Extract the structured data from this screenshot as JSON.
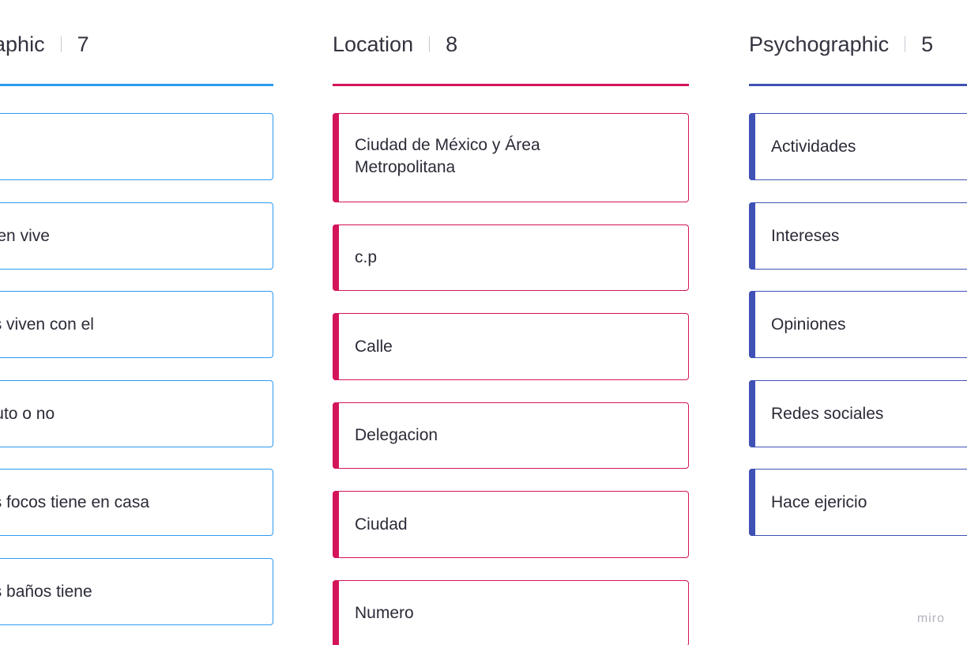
{
  "columns": [
    {
      "id": "demographic",
      "title": "Demographic",
      "count": "7",
      "color": "#2d9bf0",
      "cards": [
        {
          "text": ""
        },
        {
          "text": "Con quien vive"
        },
        {
          "text": "Cuantos viven con el"
        },
        {
          "text": "Tiene auto o no"
        },
        {
          "text": "Cuantos focos tiene en casa"
        },
        {
          "text": "Cuantos baños tiene"
        }
      ]
    },
    {
      "id": "location",
      "title": "Location",
      "count": "8",
      "color": "#d4145a",
      "cards": [
        {
          "text": "Ciudad de México y Área Metropolitana"
        },
        {
          "text": "c.p"
        },
        {
          "text": "Calle"
        },
        {
          "text": "Delegacion"
        },
        {
          "text": "Ciudad"
        },
        {
          "text": "Numero"
        }
      ]
    },
    {
      "id": "psychographic",
      "title": "Psychographic",
      "count": "5",
      "color": "#3f51b5",
      "cards": [
        {
          "text": "Actividades"
        },
        {
          "text": "Intereses"
        },
        {
          "text": "Opiniones"
        },
        {
          "text": "Redes sociales"
        },
        {
          "text": "Hace ejericio"
        }
      ]
    }
  ],
  "watermark": "miro"
}
